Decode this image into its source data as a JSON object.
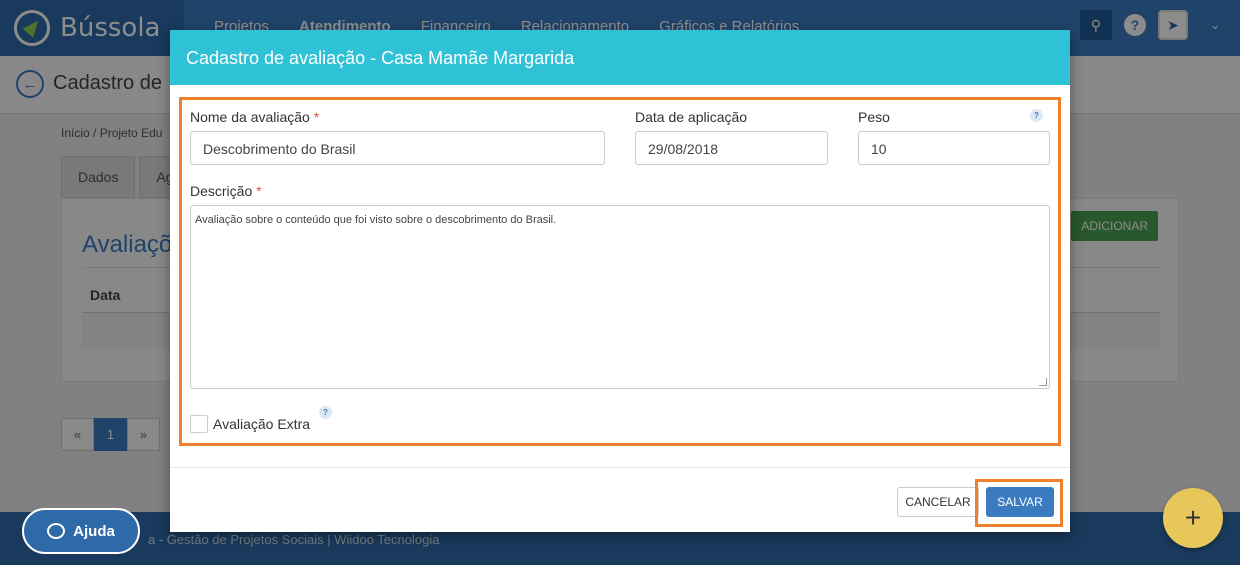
{
  "app": {
    "name": "Bússola"
  },
  "nav": {
    "items": [
      "Projetos",
      "Atendimento",
      "Financeiro",
      "Relacionamento",
      "Gráficos e Relatórios"
    ],
    "active_index": 1
  },
  "page": {
    "title": "Cadastro de",
    "breadcrumb": [
      "Início",
      "Projeto Edu"
    ],
    "tabs": [
      "Dados",
      "Ag"
    ],
    "card_title": "Avaliaçõ",
    "add_button": "ADICIONAR",
    "column_header": "Data",
    "pager": [
      "«",
      "1",
      "»"
    ]
  },
  "footer": {
    "text": "a - Gestão de Projetos Sociais  |  Wiidoo Tecnologia"
  },
  "help_button": {
    "label": "Ajuda"
  },
  "fab": {
    "label": "+"
  },
  "modal": {
    "title": "Cadastro de avaliação - Casa Mamãe Margarida",
    "fields": {
      "name": {
        "label": "Nome da avaliação",
        "value": "Descobrimento do Brasil"
      },
      "date": {
        "label": "Data de aplicação",
        "value": "29/08/2018"
      },
      "weight": {
        "label": "Peso",
        "value": "10"
      },
      "description": {
        "label": "Descrição",
        "value": "Avaliação sobre o conteúdo que foi visto sobre o descobrimento do Brasil."
      },
      "extra": {
        "label": "Avaliação Extra",
        "checked": false
      }
    },
    "required_mark": "*",
    "hint_symbol": "?",
    "cancel_label": "CANCELAR",
    "save_label": "SALVAR"
  }
}
